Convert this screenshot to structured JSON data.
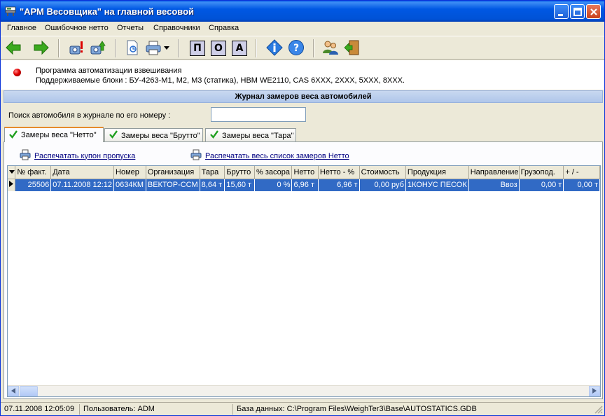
{
  "window": {
    "title": "\"АРМ Весовщика\" на главной весовой",
    "colors": {
      "titlebar": "#0058E3",
      "selection": "#316AC5",
      "tab_accent": "#E68B2C"
    }
  },
  "menu": [
    "Главное",
    "Ошибочное нетто",
    "Отчеты",
    "Справочники",
    "Справка"
  ],
  "toolbar": {
    "icons": [
      "back-arrow-icon",
      "forward-arrow-icon",
      "scale-error-icon",
      "scale-export-icon",
      "page-setup-icon",
      "printer-icon",
      "help-info-icon",
      "help-question-icon",
      "users-icon",
      "exit-door-icon"
    ],
    "letters": [
      "П",
      "О",
      "А"
    ]
  },
  "info": {
    "line1": "Программа автоматизации взвешивания",
    "line2": "Поддерживаемые блоки : БУ-4263-М1, М2, М3 (статика), HBM WE2110, CAS 6XXX, 2XXX, 5XXX, 8XXX."
  },
  "journal": {
    "title": "Журнал замеров веса автомобилей"
  },
  "search": {
    "label": "Поиск автомобиля в журнале по его номеру :",
    "value": ""
  },
  "tabs": [
    "Замеры веса \"Нетто\"",
    "Замеры веса \"Брутто\"",
    "Замеры веса \"Тара\""
  ],
  "links": {
    "print_coupon": "Распечатать купон пропуска",
    "print_all": "Распечатать весь список замеров Нетто"
  },
  "grid": {
    "columns": [
      "№ факт.",
      "Дата",
      "Номер",
      "Организация",
      "Тара",
      "Брутто",
      "% засора",
      "Нетто",
      "Нетто - %",
      "Стоимость",
      "Продукция",
      "Направление",
      "Грузопод.",
      "+ / -"
    ],
    "rows": [
      [
        "25506",
        "07.11.2008 12:12",
        "0634КМ",
        "ВЕКТОР-ССМ",
        "8,64 т",
        "15,60 т",
        "0 %",
        "6,96 т",
        "6,96 т",
        "0,00 руб",
        "1КОНУС ПЕСОК",
        "Ввоз",
        "0,00 т",
        "0,00 т"
      ]
    ]
  },
  "status": {
    "datetime": "07.11.2008 12:05:09",
    "user": "Пользователь: ADM",
    "database": "База данных: C:\\Program Files\\WeighTer3\\Base\\AUTOSTATICS.GDB"
  }
}
